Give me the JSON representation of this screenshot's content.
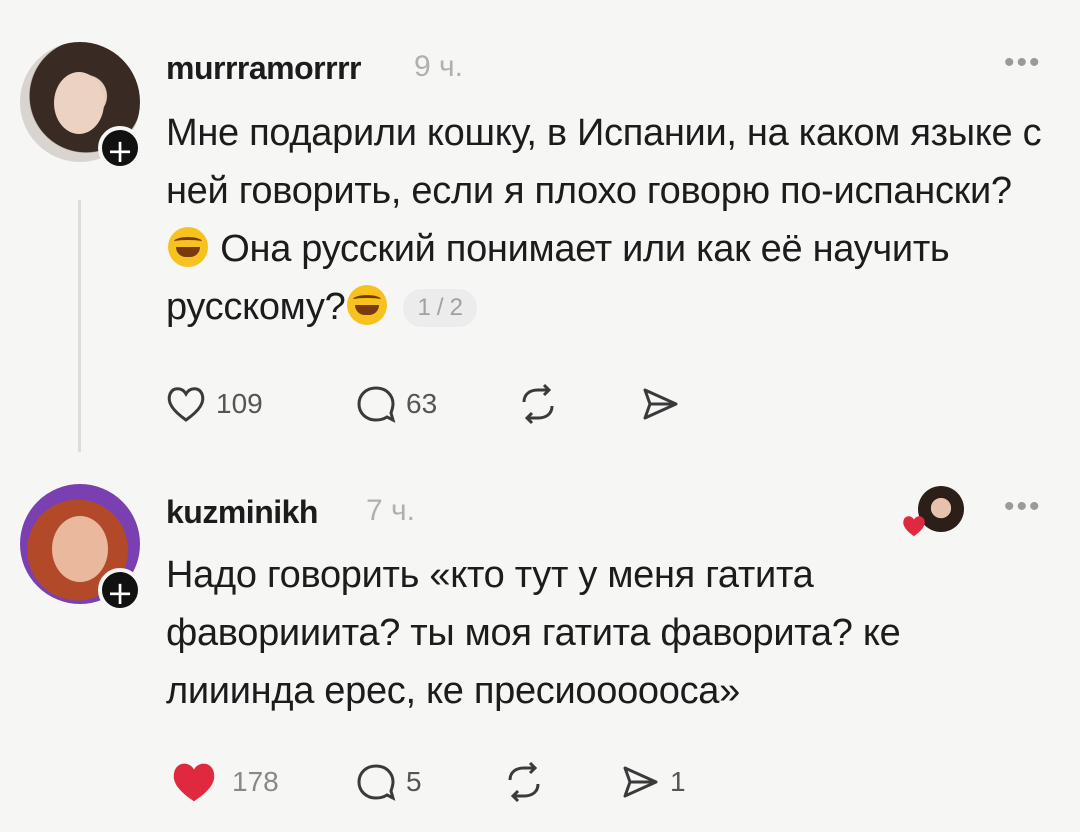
{
  "posts": [
    {
      "username": "murrramorrrr",
      "time": "9 ч.",
      "text_parts": [
        "Мне подарили кошку, в Испании, на каком языке с ней говорить, если я плохо говорю по-испански?",
        " Она русский понимает или как её научить русскому?"
      ],
      "emoji": "rofl-emoji",
      "page_indicator": "1 / 2",
      "likes": "109",
      "comments": "63",
      "reposts": "",
      "shares": ""
    },
    {
      "username": "kuzminikh",
      "time": "7 ч.",
      "text": "Надо говорить «кто тут у меня гатита фаворииита? ты моя гатита фаворита? ке лииинда ерес, ке пресиоооооса»",
      "likes": "178",
      "comments": "5",
      "reposts": "",
      "shares": "1",
      "liked": true
    }
  ],
  "more_label": "•••",
  "follow_label": "+",
  "colors": {
    "like_active": "#e0283e",
    "icon": "#3a3a3a",
    "muted": "#b0b0b0"
  },
  "icons": [
    "heart-icon",
    "comment-icon",
    "repost-icon",
    "share-icon",
    "more-icon",
    "plus-icon"
  ]
}
